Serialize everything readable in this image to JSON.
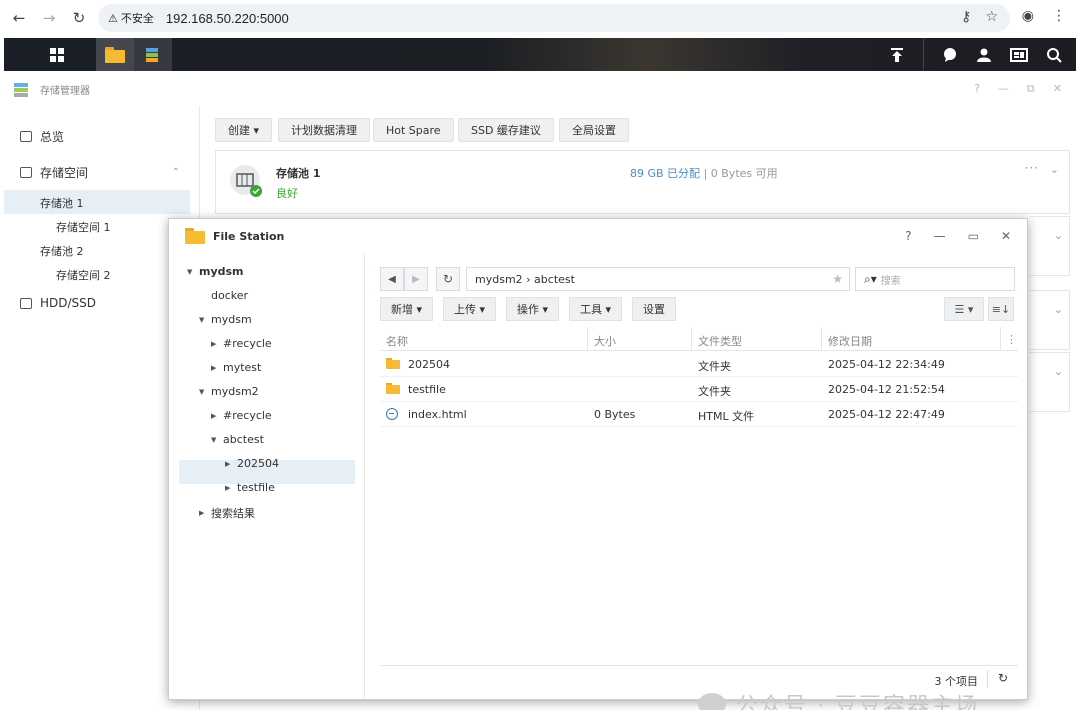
{
  "browser": {
    "security_label": "不安全",
    "url": "192.168.50.220:5000"
  },
  "storage_manager": {
    "title": "存储管理器",
    "nav": {
      "overview": "总览",
      "storage_space": "存储空间",
      "pool1": "存储池 1",
      "volume1": "存储空间 1",
      "pool2": "存储池 2",
      "volume2": "存储空间 2",
      "hdd": "HDD/SSD"
    },
    "toolbar": {
      "create": "创建",
      "schedule": "计划数据清理",
      "hot_spare": "Hot Spare",
      "ssd_cache": "SSD 缓存建议",
      "global": "全局设置"
    },
    "pool_card": {
      "name": "存储池 1",
      "status": "良好",
      "allocated": "89 GB 已分配",
      "available": "| 0 Bytes 可用"
    }
  },
  "file_station": {
    "title": "File Station",
    "tree": {
      "root": "mydsm",
      "docker": "docker",
      "mydsm": "mydsm",
      "recycle1": "#recycle",
      "mytest": "mytest",
      "mydsm2": "mydsm2",
      "recycle2": "#recycle",
      "abctest": "abctest",
      "f202504": "202504",
      "testfile": "testfile",
      "search": "搜索结果"
    },
    "path": "mydsm2 › abctest",
    "search_placeholder": "搜索",
    "toolbar": {
      "new": "新增",
      "upload": "上传",
      "action": "操作",
      "tools": "工具",
      "settings": "设置"
    },
    "columns": {
      "name": "名称",
      "size": "大小",
      "type": "文件类型",
      "modified": "修改日期"
    },
    "rows": [
      {
        "name": "202504",
        "size": "",
        "type": "文件夹",
        "modified": "2025-04-12 22:34:49"
      },
      {
        "name": "testfile",
        "size": "",
        "type": "文件夹",
        "modified": "2025-04-12 21:52:54"
      },
      {
        "name": "index.html",
        "size": "0 Bytes",
        "type": "HTML 文件",
        "modified": "2025-04-12 22:47:49"
      }
    ],
    "item_count": "3 个项目"
  },
  "watermark": "公众号 · 豆豆容器主场"
}
